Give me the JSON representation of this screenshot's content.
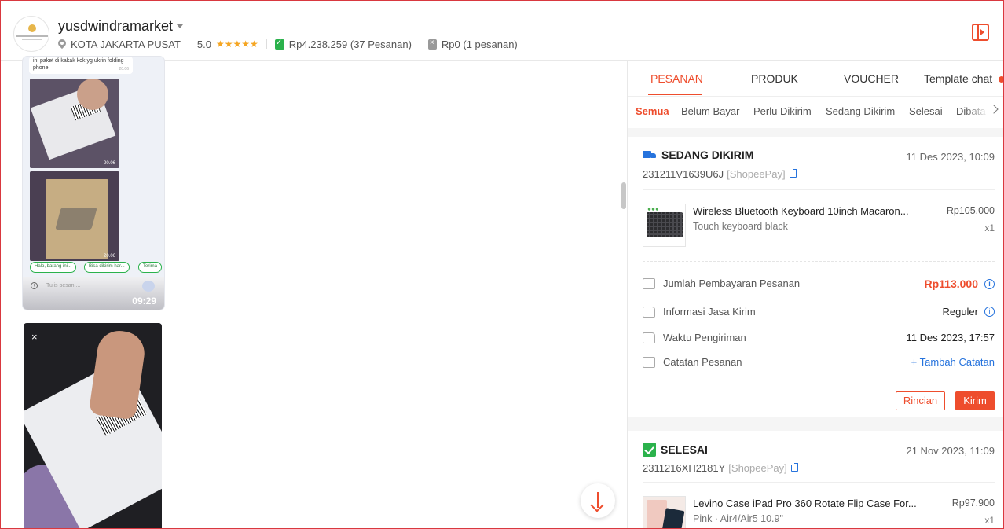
{
  "header": {
    "shop_name": "yusdwindramarket",
    "location": "KOTA JAKARTA PUSAT",
    "rating": "5.0",
    "stars": "★★★★★",
    "paid_summary": "Rp4.238.259 (37 Pesanan)",
    "unpaid_summary": "Rp0 (1 pesanan)"
  },
  "chat": {
    "bubble_text": "ini paket di kakak kok yg ukrin folding phone",
    "bubble_time": "20.06",
    "photo1_time": "20.06",
    "photo2_time": "20.06",
    "quick_replies": [
      "Halo, barang ini...",
      "Bisa dikirim har...",
      "Terima"
    ],
    "input_placeholder": "Tulis pesan ...",
    "status_time": "09:29",
    "close_glyph": "×"
  },
  "panel": {
    "tabs": [
      "PESANAN",
      "PRODUK",
      "VOUCHER",
      "Template chat"
    ],
    "subtabs": [
      "Semua",
      "Belum Bayar",
      "Perlu Dikirim",
      "Sedang Dikirim",
      "Selesai",
      "Dibata"
    ]
  },
  "orders": [
    {
      "status": "SEDANG DIKIRIM",
      "date": "11 Des 2023, 10:09",
      "order_id": "231211V1639U6J",
      "payment": "[ShopeePay]",
      "product_name": "Wireless Bluetooth Keyboard 10inch Macaron...",
      "variant": "Touch keyboard black",
      "price": "Rp105.000",
      "qty": "x1",
      "rows": {
        "total_label": "Jumlah Pembayaran Pesanan",
        "total_value": "Rp113.000",
        "shipping_label": "Informasi Jasa Kirim",
        "shipping_value": "Reguler",
        "time_label": "Waktu Pengiriman",
        "time_value": "11 Des 2023, 17:57",
        "note_label": "Catatan Pesanan",
        "note_value": "+ Tambah Catatan"
      },
      "btn_detail": "Rincian",
      "btn_send": "Kirim"
    },
    {
      "status": "SELESAI",
      "date": "21 Nov 2023, 11:09",
      "order_id": "2311216XH2181Y",
      "payment": "[ShopeePay]",
      "product_name": "Levino Case iPad Pro 360 Rotate Flip Case For...",
      "variant": "Pink · Air4/Air5 10.9\"",
      "price": "Rp97.900",
      "qty": "x1"
    }
  ],
  "colors": {
    "accent": "#ee4d2d",
    "link": "#2673dd",
    "success": "#2bb24c"
  }
}
